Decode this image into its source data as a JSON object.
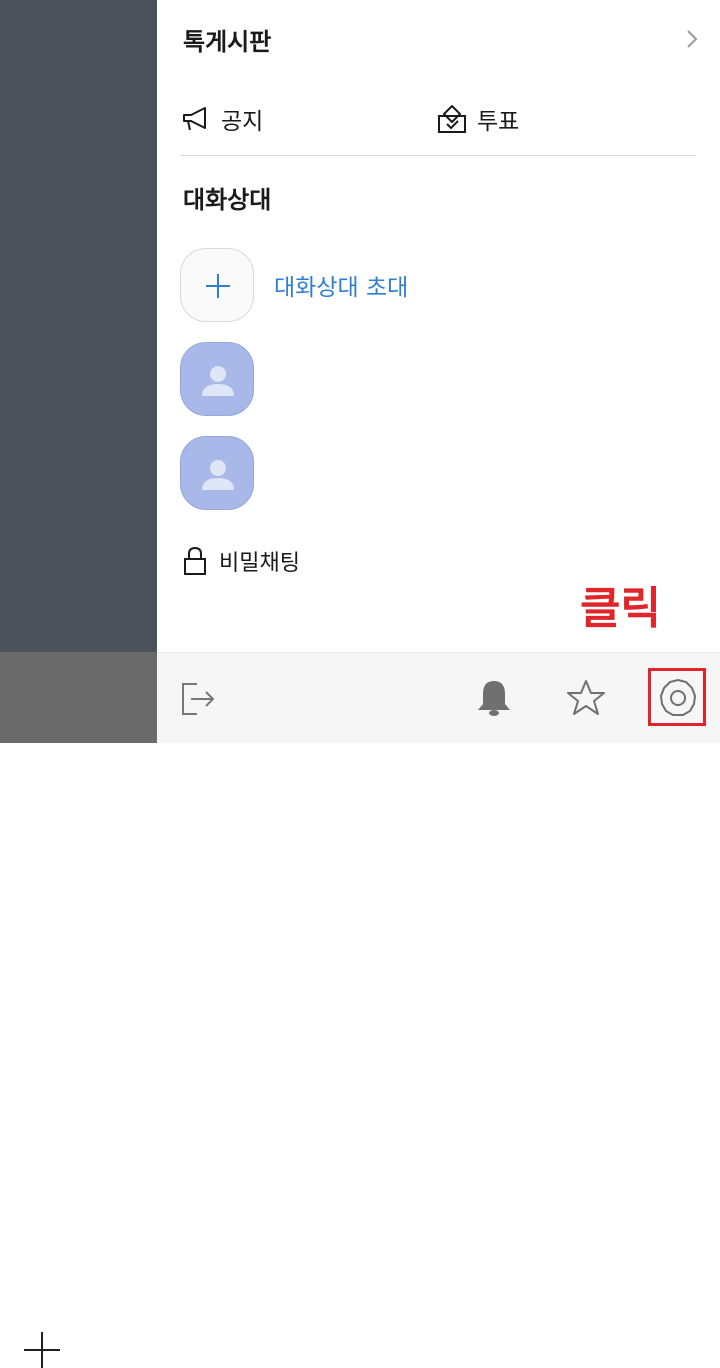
{
  "board": {
    "title": "톡게시판"
  },
  "menu": {
    "notice_label": "공지",
    "vote_label": "투표"
  },
  "members": {
    "section_title": "대화상대",
    "invite_label": "대화상대 초대"
  },
  "secret_chat_label": "비밀채팅",
  "annotation": {
    "text": "클릭",
    "color": "#e0262a"
  },
  "accent_color": "#2f7fd1",
  "icons": [
    "chevron-right-icon",
    "megaphone-icon",
    "ballot-box-icon",
    "plus-icon",
    "person-icon",
    "lock-icon",
    "exit-icon",
    "bell-icon",
    "star-icon",
    "gear-icon"
  ]
}
